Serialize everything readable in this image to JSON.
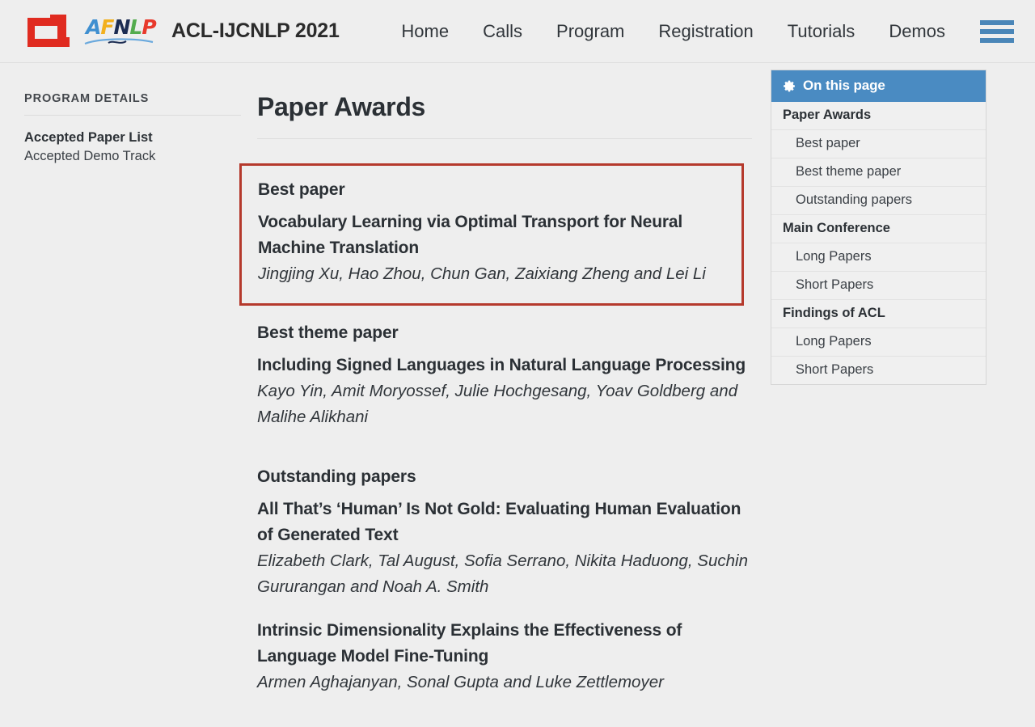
{
  "header": {
    "logo_acl": "acl-logo",
    "logo_afnlp": "afnlp-logo",
    "afnlp_letters": [
      "A",
      "F",
      "N",
      "L",
      "P"
    ],
    "conference_title": "ACL-IJCNLP 2021",
    "nav": [
      {
        "label": "Home"
      },
      {
        "label": "Calls"
      },
      {
        "label": "Program"
      },
      {
        "label": "Registration"
      },
      {
        "label": "Tutorials"
      },
      {
        "label": "Demos"
      }
    ],
    "menu_icon": "hamburger-menu-icon",
    "colors": {
      "acl_red": "#e02b20",
      "hamburger_blue": "#4a86b8",
      "background": "#eeeeee"
    }
  },
  "sidebar": {
    "heading": "PROGRAM DETAILS",
    "items": [
      {
        "label": "Accepted Paper List",
        "active": true
      },
      {
        "label": "Accepted Demo Track",
        "active": false
      }
    ]
  },
  "main": {
    "page_title": "Paper Awards",
    "sections": [
      {
        "label": "Best paper",
        "highlighted": true,
        "highlight_color": "#b5392c",
        "papers": [
          {
            "title": "Vocabulary Learning via Optimal Transport for Neural Machine Translation",
            "authors": "Jingjing Xu, Hao Zhou, Chun Gan, Zaixiang Zheng and Lei Li"
          }
        ]
      },
      {
        "label": "Best theme paper",
        "highlighted": false,
        "papers": [
          {
            "title": "Including Signed Languages in Natural Language Processing",
            "authors": "Kayo Yin, Amit Moryossef, Julie Hochgesang, Yoav Goldberg and Malihe Alikhani"
          }
        ]
      },
      {
        "label": "Outstanding papers",
        "highlighted": false,
        "papers": [
          {
            "title": "All That’s ‘Human’ Is Not Gold: Evaluating Human Evaluation of Generated Text",
            "authors": "Elizabeth Clark, Tal August, Sofia Serrano, Nikita Haduong, Suchin Gururangan and Noah A. Smith"
          },
          {
            "title": "Intrinsic Dimensionality Explains the Effectiveness of Language Model Fine-Tuning",
            "authors": "Armen Aghajanyan, Sonal Gupta and Luke Zettlemoyer"
          }
        ]
      }
    ]
  },
  "toc": {
    "header_label": "On this page",
    "header_icon": "gear-icon",
    "header_color": "#4a8bc2",
    "items": [
      {
        "label": "Paper Awards",
        "level": "group"
      },
      {
        "label": "Best paper",
        "level": "sub"
      },
      {
        "label": "Best theme paper",
        "level": "sub"
      },
      {
        "label": "Outstanding papers",
        "level": "sub"
      },
      {
        "label": "Main Conference",
        "level": "group"
      },
      {
        "label": "Long Papers",
        "level": "sub"
      },
      {
        "label": "Short Papers",
        "level": "sub"
      },
      {
        "label": "Findings of ACL",
        "level": "group"
      },
      {
        "label": "Long Papers",
        "level": "sub"
      },
      {
        "label": "Short Papers",
        "level": "sub"
      }
    ]
  }
}
